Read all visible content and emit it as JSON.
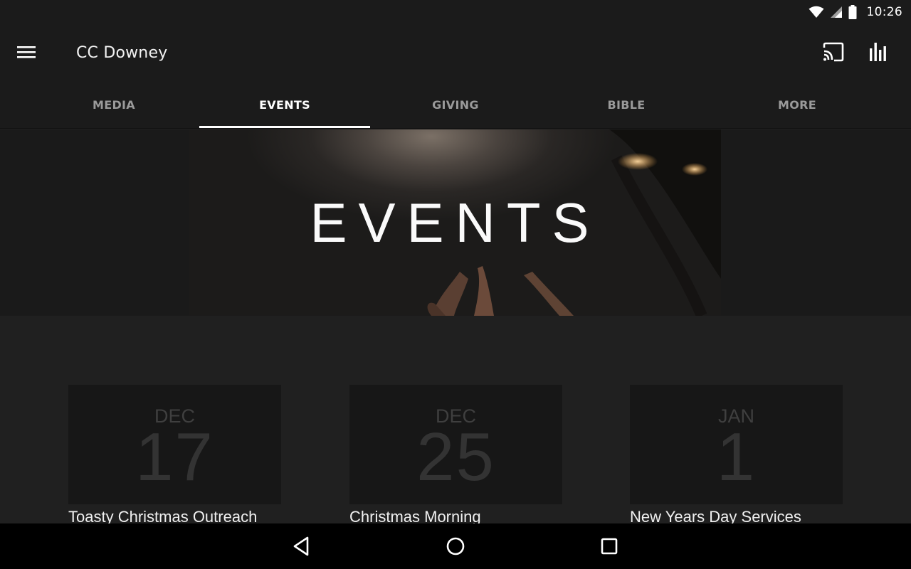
{
  "status_bar": {
    "time": "10:26"
  },
  "app_bar": {
    "title": "CC Downey"
  },
  "tabs": [
    {
      "label": "MEDIA",
      "active": false
    },
    {
      "label": "EVENTS",
      "active": true
    },
    {
      "label": "GIVING",
      "active": false
    },
    {
      "label": "BIBLE",
      "active": false
    },
    {
      "label": "MORE",
      "active": false
    }
  ],
  "hero": {
    "title": "EVENTS"
  },
  "events": [
    {
      "month": "DEC",
      "day": "17",
      "title": "Toasty Christmas Outreach"
    },
    {
      "month": "DEC",
      "day": "25",
      "title": "Christmas Morning"
    },
    {
      "month": "JAN",
      "day": "1",
      "title": "New Years Day Services"
    }
  ],
  "icons": {
    "menu": "menu-icon",
    "cast": "cast-icon",
    "stats": "bar-chart-icon",
    "wifi": "wifi-icon",
    "signal": "cell-signal-icon",
    "battery": "battery-icon",
    "back": "back-triangle-icon",
    "home": "home-circle-icon",
    "recents": "recents-square-icon"
  },
  "colors": {
    "background": "#202020",
    "app_bar": "#1b1b1b",
    "card": "#171717",
    "active_tab": "#ffffff",
    "inactive_tab": "#9a9a9a"
  }
}
